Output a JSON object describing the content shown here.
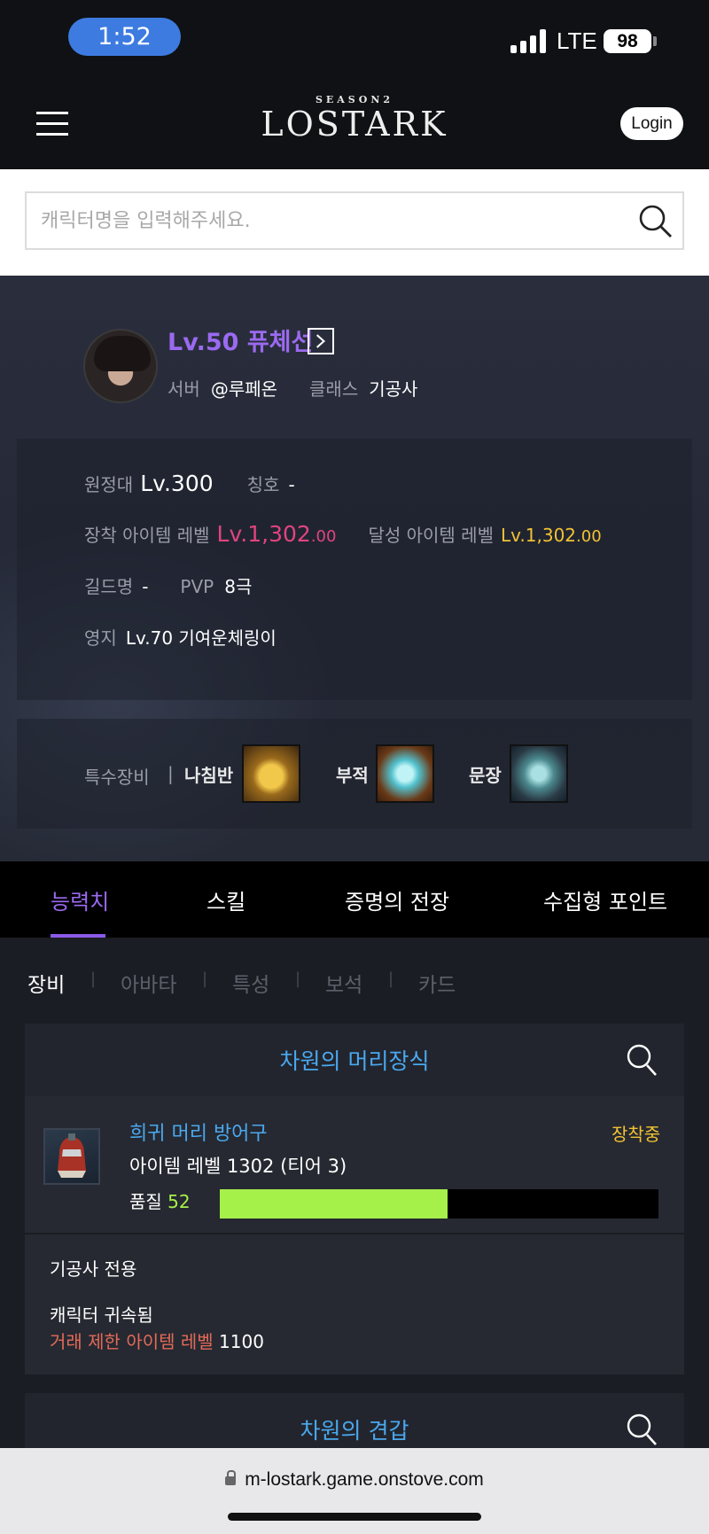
{
  "status_bar": {
    "time": "1:52",
    "network": "LTE",
    "battery": "98"
  },
  "header": {
    "logo_season": "SEASON2",
    "logo_main": "LOSTARK",
    "login_label": "Login"
  },
  "search": {
    "placeholder": "캐릭터명을 입력해주세요."
  },
  "profile": {
    "name": "Lv.50 퓨체선",
    "server_label": "서버",
    "server_value": "@루페온",
    "class_label": "클래스",
    "class_value": "기공사",
    "expedition_label": "원정대",
    "expedition_value": "Lv.300",
    "title_label": "칭호",
    "title_value": "-",
    "equip_level_label": "장착 아이템 레벨",
    "equip_level_main": "Lv.1,302",
    "equip_level_dec": ".00",
    "achieved_level_label": "달성 아이템 레벨",
    "achieved_level_main": "Lv.1,302",
    "achieved_level_dec": ".00",
    "guild_label": "길드명",
    "guild_value": "-",
    "pvp_label": "PVP",
    "pvp_value": "8극",
    "estate_label": "영지",
    "estate_value": "Lv.70 기여운체링이",
    "special_gear_label": "특수장비",
    "special_gear_sep": "|",
    "special_gear": [
      "나침반",
      "부적",
      "문장"
    ]
  },
  "tabs": [
    "능력치",
    "스킬",
    "증명의 전장",
    "수집형 포인트"
  ],
  "subtabs": [
    "장비",
    "아바타",
    "특성",
    "보석",
    "카드"
  ],
  "subtab_sep": "|",
  "item_card": {
    "title": "차원의 머리장식",
    "item_name": "희귀 머리 방어구",
    "status": "장착중",
    "item_level": "아이템 레벨 1302 (티어 3)",
    "quality_label": "품질",
    "quality_value": "52",
    "quality_fraction": 0.52,
    "class_only": "기공사 전용",
    "bound": "캐릭터 귀속됨",
    "trade_limit_label": "거래 제한 아이템 레벨",
    "trade_limit_value": "1100"
  },
  "next_card": {
    "title": "차원의 견갑"
  },
  "browser": {
    "url": "m-lostark.game.onstove.com"
  },
  "colors": {
    "accent_purple": "#9b6af0",
    "item_blue": "#4aa8ee",
    "equip_level_pink": "#e0447e",
    "achieved_level_gold": "#f1c232",
    "quality_green": "#a6f04a",
    "trade_red": "#e36a58"
  }
}
